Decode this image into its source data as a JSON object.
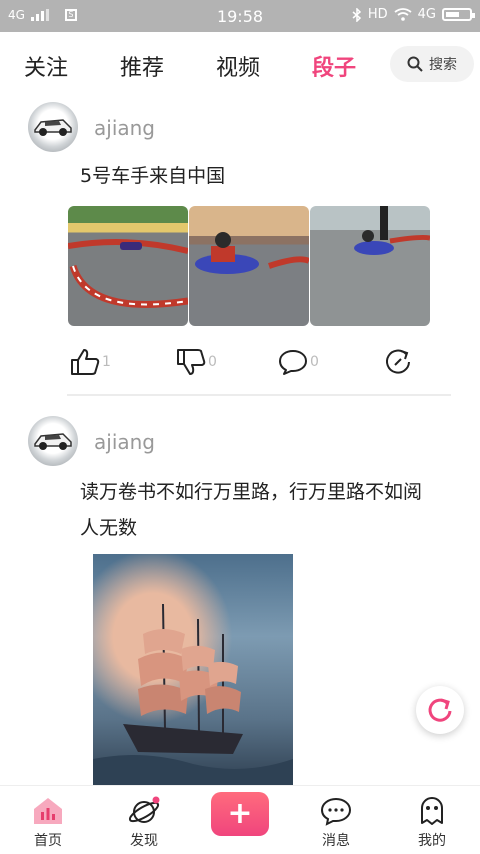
{
  "status_bar": {
    "network": "4G",
    "sim": "S",
    "time": "19:58",
    "right_network": "HD",
    "right_network2": "4G",
    "battery_level": 0.6
  },
  "top_nav": {
    "tabs": [
      {
        "label": "关注"
      },
      {
        "label": "推荐"
      },
      {
        "label": "视频"
      },
      {
        "label": "段子"
      }
    ],
    "active_tab": "段子",
    "search_label": "搜索",
    "accent_color": "#f0457d"
  },
  "posts": [
    {
      "username": "ajiang",
      "text": "5号车手来自中国",
      "images": [
        "go-kart-track-photo",
        "go-kart-driver-photo",
        "go-kart-track-photo"
      ],
      "likes": "1",
      "dislikes": "0",
      "comments": "0"
    },
    {
      "username": "ajiang",
      "text": "读万卷书不如行万里路，行万里路不如阅人无数",
      "images": [
        "sailing-ship-painting"
      ]
    }
  ],
  "bottom_nav": {
    "items": [
      {
        "label": "首页",
        "icon": "home-icon"
      },
      {
        "label": "发现",
        "icon": "planet-icon"
      },
      {
        "label": "+",
        "icon": "plus-icon"
      },
      {
        "label": "消息",
        "icon": "message-icon"
      },
      {
        "label": "我的",
        "icon": "ghost-icon"
      }
    ]
  }
}
